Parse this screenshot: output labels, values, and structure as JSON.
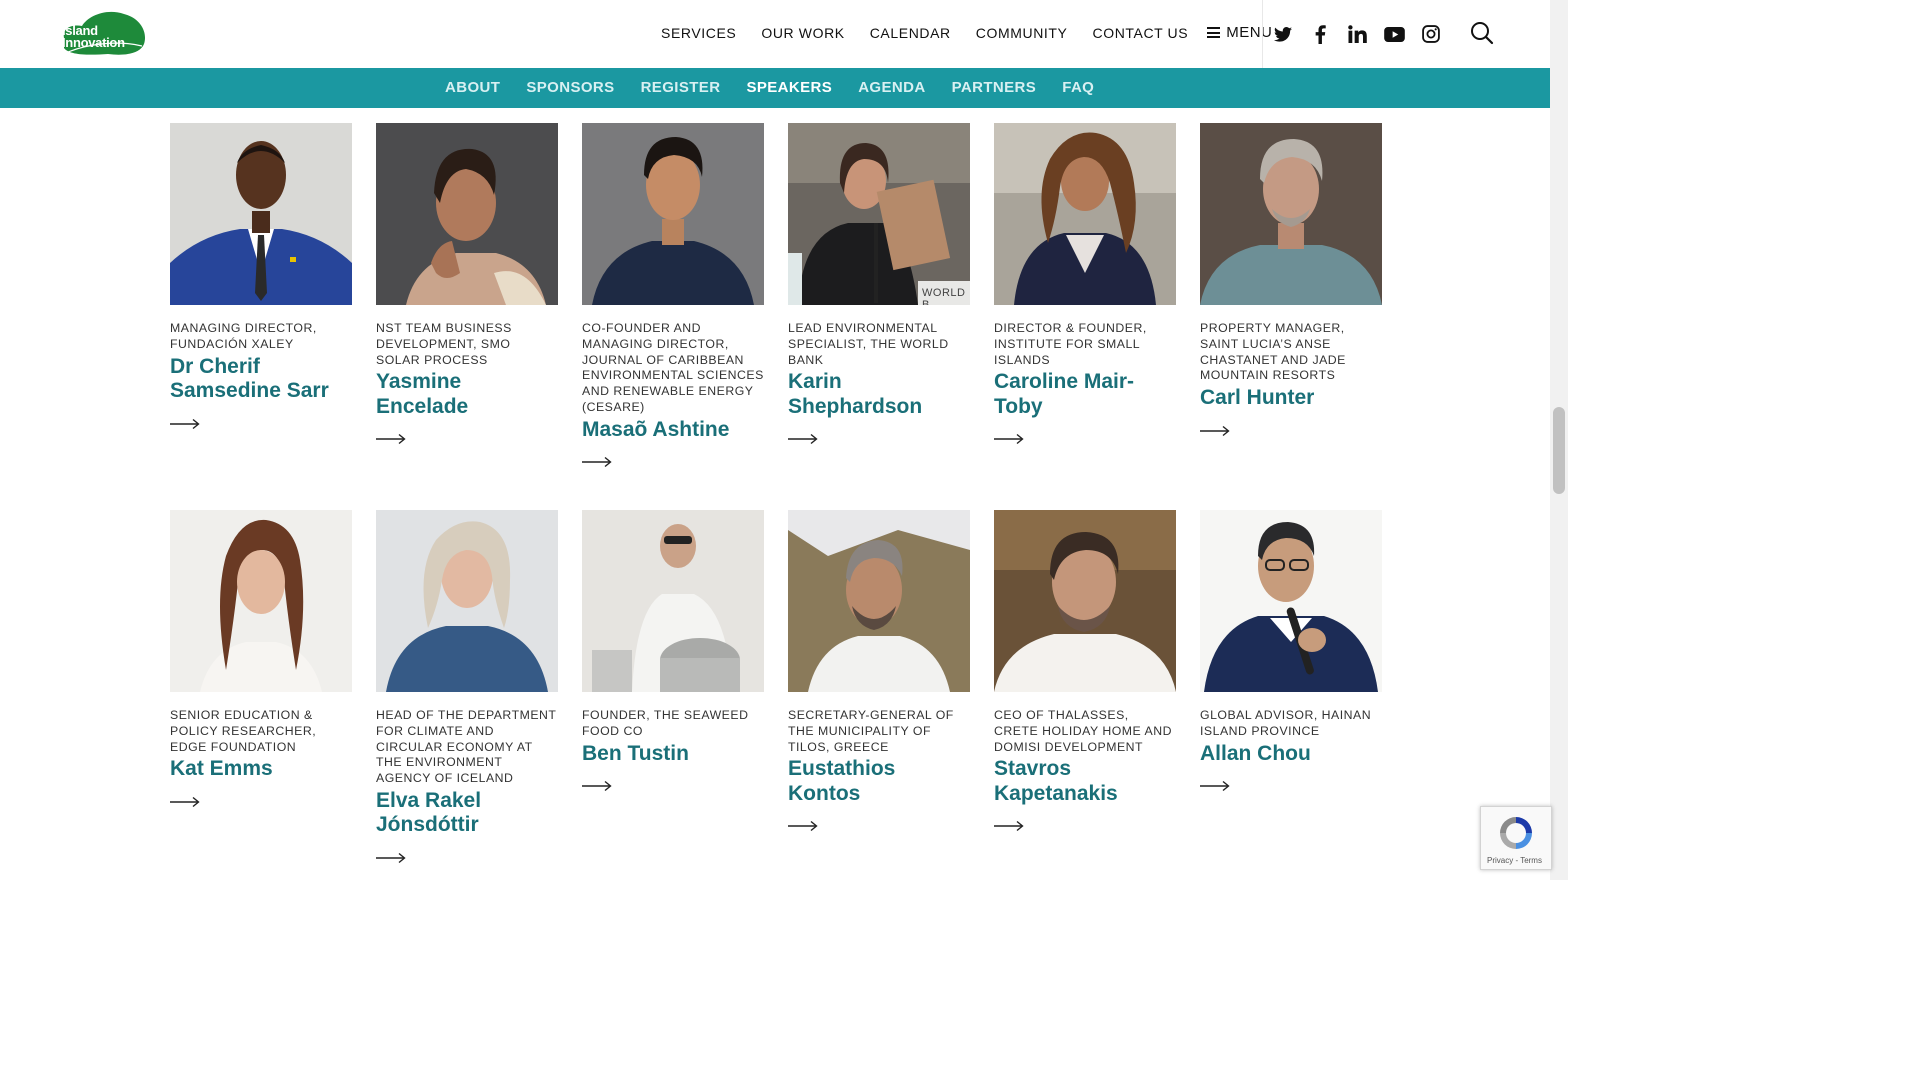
{
  "header": {
    "logo_text_line1": "Island",
    "logo_text_line2": "Innovation",
    "nav": [
      "SERVICES",
      "OUR WORK",
      "CALENDAR",
      "COMMUNITY",
      "CONTACT US"
    ],
    "menu_label": "MENU",
    "socials": [
      "twitter-icon",
      "facebook-icon",
      "linkedin-icon",
      "youtube-icon",
      "instagram-icon"
    ]
  },
  "subnav": {
    "items": [
      "ABOUT",
      "SPONSORS",
      "REGISTER",
      "SPEAKERS",
      "AGENDA",
      "PARTNERS",
      "FAQ"
    ],
    "active": "SPEAKERS"
  },
  "colors": {
    "teal": "#1b98a1",
    "name_color": "#1a6f78",
    "logo_green": "#1e8a3a"
  },
  "speakers": [
    {
      "role": "MANAGING DIRECTOR, FUNDACIÓN XALEY",
      "name": "Dr Cherif Samsedine Sarr"
    },
    {
      "role": "NST TEAM BUSINESS DEVELOPMENT, SMO SOLAR PROCESS",
      "name": "Yasmine Encelade"
    },
    {
      "role": "CO-FOUNDER AND MANAGING DIRECTOR, JOURNAL OF CARIBBEAN ENVIRONMENTAL SCIENCES AND RENEWABLE ENERGY (CESARE)",
      "name": "Masaõ Ashtine"
    },
    {
      "role": "LEAD ENVIRONMENTAL SPECIALIST, THE WORLD BANK",
      "name": "Karin Shephardson",
      "photo_text": "WORLD B"
    },
    {
      "role": "DIRECTOR & FOUNDER, INSTITUTE FOR SMALL ISLANDS",
      "name": "Caroline Mair-Toby"
    },
    {
      "role": "PROPERTY MANAGER, SAINT LUCIA’S ANSE CHASTANET AND JADE MOUNTAIN RESORTS",
      "name": "Carl Hunter"
    },
    {
      "role": "SENIOR EDUCATION & POLICY RESEARCHER, EDGE FOUNDATION",
      "name": "Kat Emms"
    },
    {
      "role": "HEAD OF THE DEPARTMENT FOR CLIMATE AND CIRCULAR ECONOMY AT THE ENVIRONMENT AGENCY OF ICELAND",
      "name": "Elva Rakel Jónsdóttir"
    },
    {
      "role": "FOUNDER, THE SEAWEED FOOD CO",
      "name": "Ben Tustin"
    },
    {
      "role": "SECRETARY-GENERAL OF THE MUNICIPALITY OF TILOS, GREECE",
      "name": "Eustathios Kontos"
    },
    {
      "role": "CEO OF THALASSES, CRETE HOLIDAY HOME AND DOMISI DEVELOPMENT",
      "name": "Stavros Kapetanakis"
    },
    {
      "role": "GLOBAL ADVISOR, HAINAN ISLAND PROVINCE",
      "name": "Allan Chou"
    }
  ],
  "recaptcha": {
    "links": "Privacy - Terms"
  }
}
